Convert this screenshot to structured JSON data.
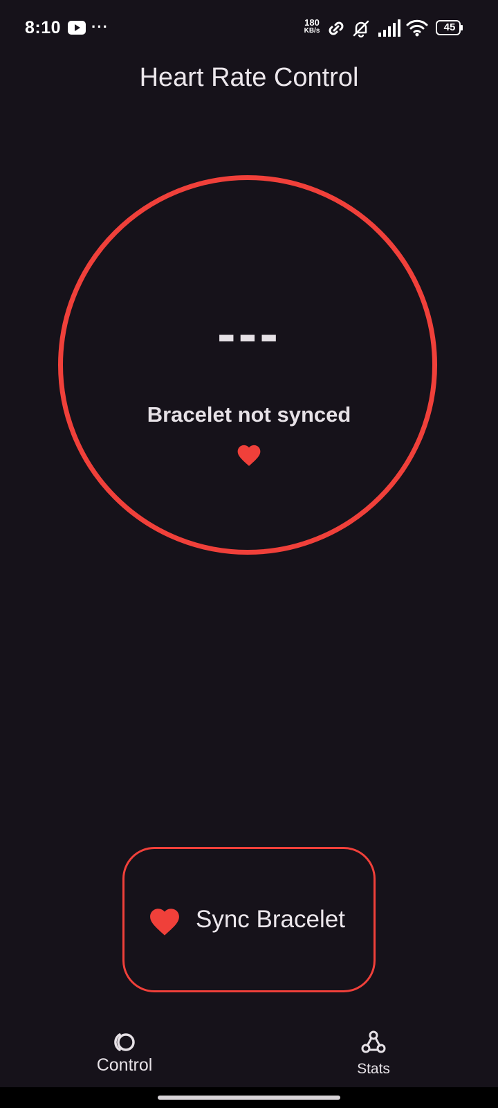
{
  "status_bar": {
    "time": "8:10",
    "more": "···",
    "net_speed_value": "180",
    "net_speed_unit": "KB/s",
    "battery": "45",
    "icons": [
      "youtube-icon",
      "more-icon",
      "link-icon",
      "mute-icon",
      "signal-icon",
      "wifi-icon",
      "battery-icon"
    ]
  },
  "header": {
    "title": "Heart Rate Control"
  },
  "monitor": {
    "value": "---",
    "status": "Bracelet not synced",
    "icon": "heart-icon",
    "accent_color": "#f0403a"
  },
  "sync_button": {
    "label": "Sync Bracelet",
    "icon": "heart-icon"
  },
  "nav": {
    "items": [
      {
        "label": "Control",
        "icon": "control-icon",
        "selected": true
      },
      {
        "label": "Stats",
        "icon": "webhook-icon",
        "selected": false
      }
    ]
  },
  "colors": {
    "background": "#16121a",
    "accent": "#f0403a",
    "text": "#e6e1e6"
  }
}
